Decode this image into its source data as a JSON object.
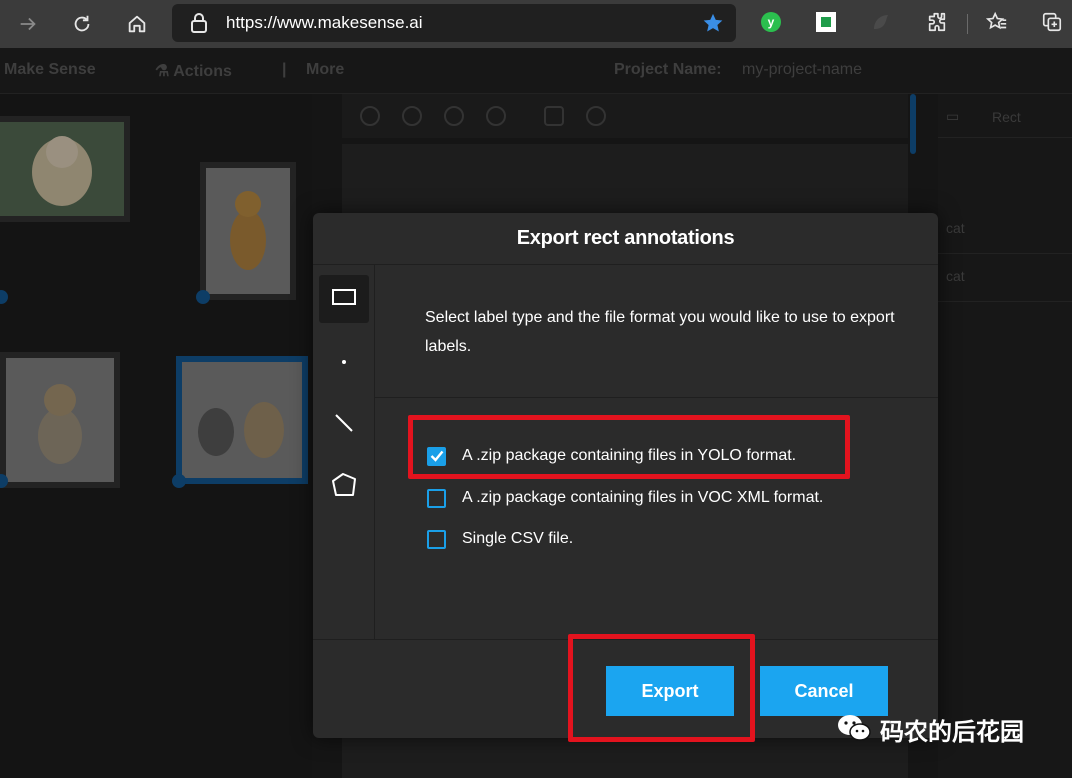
{
  "browser": {
    "url": "https://www.makesense.ai",
    "accent_color": "#1a9fe8"
  },
  "app": {
    "menu": [
      "Make Sense",
      "Actions",
      "More"
    ],
    "project_label": "Project Name:",
    "project_name": "my-project-name",
    "right_panel": {
      "tool_label": "Rect",
      "labels": [
        "cat",
        "cat"
      ]
    }
  },
  "modal": {
    "title": "Export rect annotations",
    "description": "Select label type and the file format you would like to use to export labels.",
    "label_types": [
      "rect-icon",
      "point-icon",
      "line-icon",
      "polygon-icon"
    ],
    "options": [
      {
        "label": "A .zip package containing files in YOLO format.",
        "checked": true
      },
      {
        "label": "A .zip package containing files in VOC XML format.",
        "checked": false
      },
      {
        "label": "Single CSV file.",
        "checked": false
      }
    ],
    "export_label": "Export",
    "cancel_label": "Cancel",
    "button_color": "#1ba5f0"
  },
  "highlight_color": "#e3131e",
  "watermark": {
    "text": "码农的后花园"
  }
}
